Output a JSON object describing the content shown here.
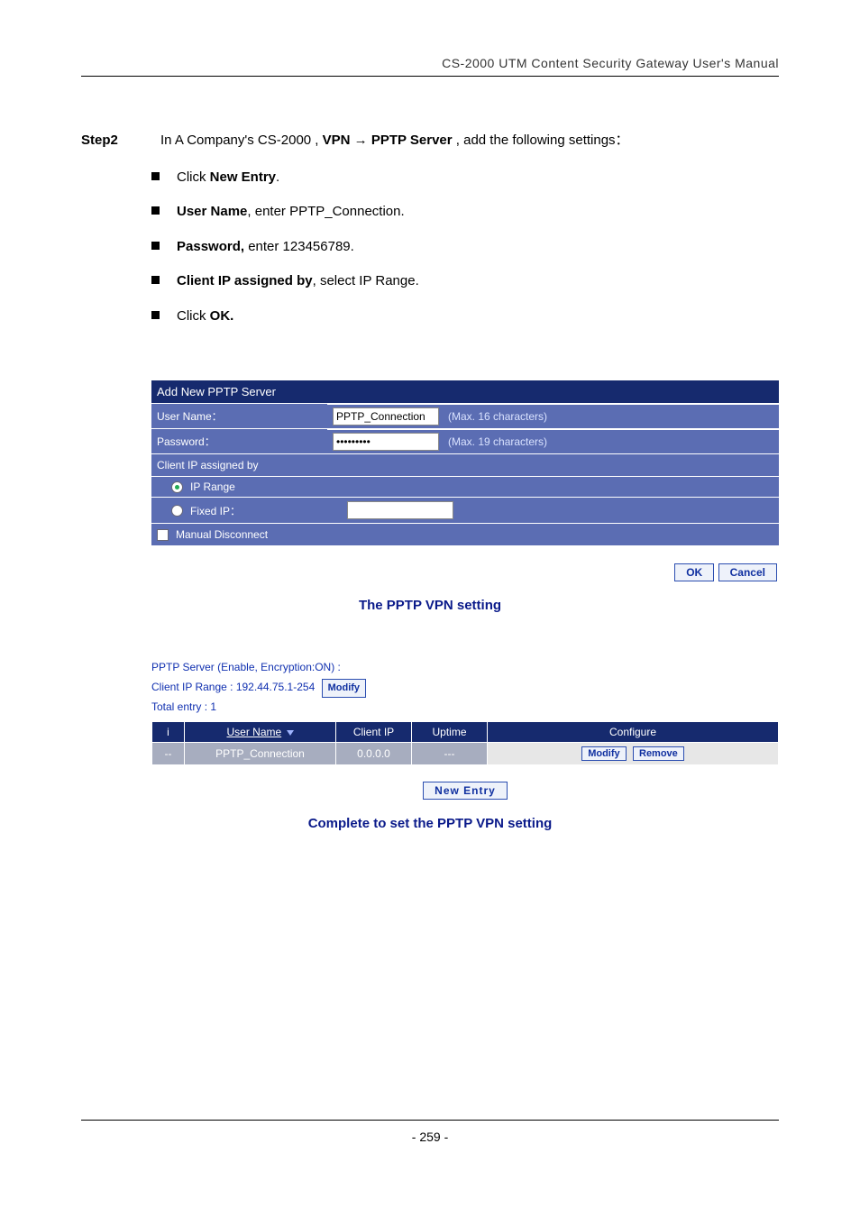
{
  "header": "CS-2000 UTM Content Security Gateway User's Manual",
  "step": {
    "label": "Step2",
    "text_pre": "In A Company's CS-2000 , ",
    "vpn": "VPN",
    "arrow": " → ",
    "pptp": "PPTP Server",
    "text_post": " , add the following settings："
  },
  "bullets": {
    "b1_a": "Click ",
    "b1_b": "New Entry",
    "b1_c": ".",
    "b2_a": "User Name",
    "b2_b": ", enter PPTP_Connection.",
    "b3_a": "Password,",
    "b3_b": " enter 123456789.",
    "b4_a": "Client IP assigned by",
    "b4_b": ", select IP Range.",
    "b5_a": "Click ",
    "b5_b": "OK."
  },
  "form": {
    "title": "Add New PPTP Server",
    "user_label": "User Name：",
    "user_value": "PPTP_Connection",
    "user_hint": "(Max. 16 characters)",
    "pass_label": "Password：",
    "pass_value": "•••••••••",
    "pass_hint": "(Max. 19 characters)",
    "client_assigned": "Client IP assigned by",
    "ip_range": "IP Range",
    "fixed_ip": "Fixed IP：",
    "fixed_ip_value": "",
    "manual_disconnect": "Manual Disconnect"
  },
  "buttons": {
    "ok": "OK",
    "cancel": "Cancel",
    "modify": "Modify",
    "remove": "Remove",
    "new_entry": "New Entry"
  },
  "caption1": "The PPTP VPN setting",
  "list": {
    "line1": "PPTP Server (Enable, Encryption:ON) :",
    "line2": "Client IP Range : 192.44.75.1-254",
    "line3": "Total entry : 1",
    "col_i": "i",
    "col_user": "User Name",
    "col_clientip": "Client IP",
    "col_uptime": "Uptime",
    "col_configure": "Configure",
    "row_i": "--",
    "row_user": "PPTP_Connection",
    "row_ip": "0.0.0.0",
    "row_uptime": "---"
  },
  "caption2": "Complete to set the PPTP VPN setting",
  "page_num": "- 259 -"
}
